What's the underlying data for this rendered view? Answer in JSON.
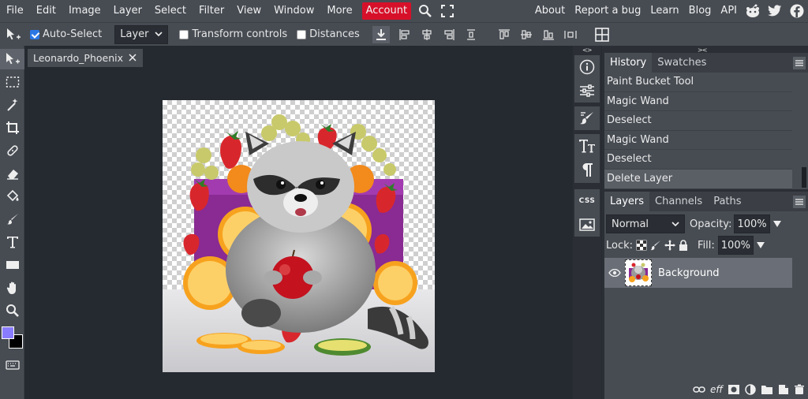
{
  "menu": {
    "items": [
      "File",
      "Edit",
      "Image",
      "Layer",
      "Select",
      "Filter",
      "View",
      "Window",
      "More"
    ],
    "account": "Account",
    "right": [
      "About",
      "Report a bug",
      "Learn",
      "Blog",
      "API"
    ]
  },
  "options": {
    "auto_select": "Auto-Select",
    "layer_select": "Layer",
    "transform_controls": "Transform controls",
    "distances": "Distances"
  },
  "document": {
    "tab_title": "Leonardo_Phoenix"
  },
  "colors": {
    "foreground": "#8a7cff",
    "background": "#000000",
    "accent": "#d7102a"
  },
  "history": {
    "tabs": [
      "History",
      "Swatches"
    ],
    "items": [
      "Paint Bucket Tool",
      "Magic Wand",
      "Deselect",
      "Magic Wand",
      "Deselect",
      "Delete Layer"
    ]
  },
  "layers": {
    "tabs": [
      "Layers",
      "Channels",
      "Paths"
    ],
    "blend_mode": "Normal",
    "opacity_label": "Opacity:",
    "opacity_value": "100%",
    "lock_label": "Lock:",
    "fill_label": "Fill:",
    "fill_value": "100%",
    "layer_name": "Background",
    "footer_fx": "eff"
  },
  "panel_icons": {
    "css": "CSS"
  }
}
